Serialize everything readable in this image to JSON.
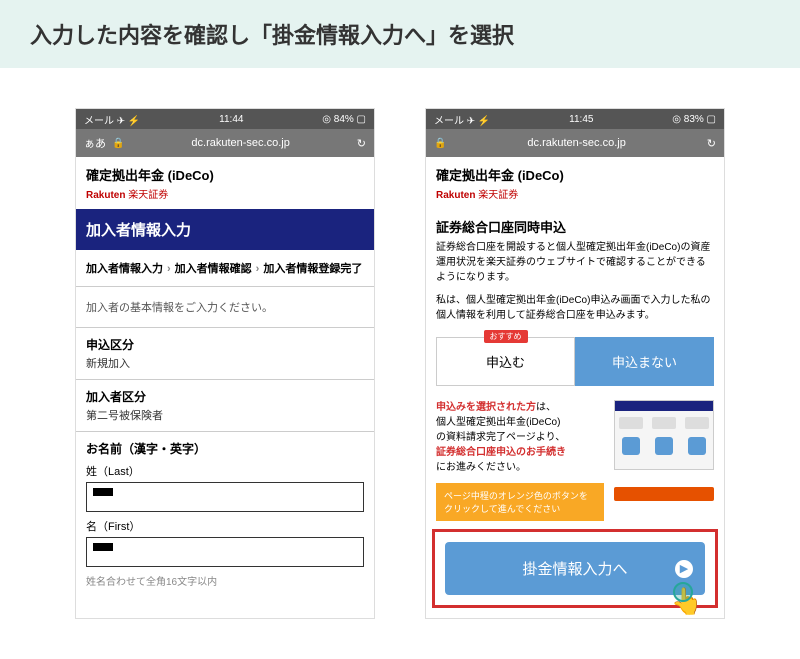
{
  "banner": "入力した内容を確認し「掛金情報入力へ」を選択",
  "left": {
    "status": {
      "carrier": "メール ✈ ⚡",
      "time": "11:44",
      "battery": "◎ 84% ▢"
    },
    "addr": {
      "aa": "ぁあ",
      "url": "dc.rakuten-sec.co.jp"
    },
    "page_title": "確定拠出年金 (iDeCo)",
    "brand_bold": "Rakuten",
    "brand_jp": "楽天証券",
    "section_header": "加入者情報入力",
    "breadcrumb": {
      "step1": "加入者情報入力",
      "step2": "加入者情報確認",
      "step3": "加入者情報登録完了"
    },
    "instruction": "加入者の基本情報をご入力ください。",
    "fields": {
      "kubun_label": "申込区分",
      "kubun_value": "新規加入",
      "member_kubun_label": "加入者区分",
      "member_kubun_value": "第二号被保険者",
      "name_label": "お名前（漢字・英字）",
      "last_label": "姓（Last）",
      "first_label": "名（First）",
      "hint": "姓名合わせて全角16文字以内"
    }
  },
  "right": {
    "status": {
      "carrier": "メール ✈ ⚡",
      "time": "11:45",
      "battery": "◎ 83% ▢"
    },
    "addr": {
      "url": "dc.rakuten-sec.co.jp"
    },
    "page_title": "確定拠出年金 (iDeCo)",
    "brand_bold": "Rakuten",
    "brand_jp": "楽天証券",
    "section_title": "証券総合口座同時申込",
    "desc1": "証券総合口座を開設すると個人型確定拠出年金(iDeCo)の資産運用状況を楽天証券のウェブサイトで確認することができるようになります。",
    "desc2_a": "私は、個人型確定拠出年金(iDeCo)申込み画面で入力した私の個人情報を利用して証券総合口座を申込みます。",
    "badge": "おすすめ",
    "choice_apply": "申込む",
    "choice_skip": "申込まない",
    "info_red1": "申込みを選択された方",
    "info_plain1": "は、",
    "info_line2": "個人型確定拠出年金(iDeCo)",
    "info_line3": "の資料請求完了ページより、",
    "info_red2": "証券総合口座申込のお手続き",
    "info_line4": "にお進みください。",
    "orange_tip": "ページ中程のオレンジ色のボタンをクリックして進んでください",
    "cta": "掛金情報入力へ"
  }
}
